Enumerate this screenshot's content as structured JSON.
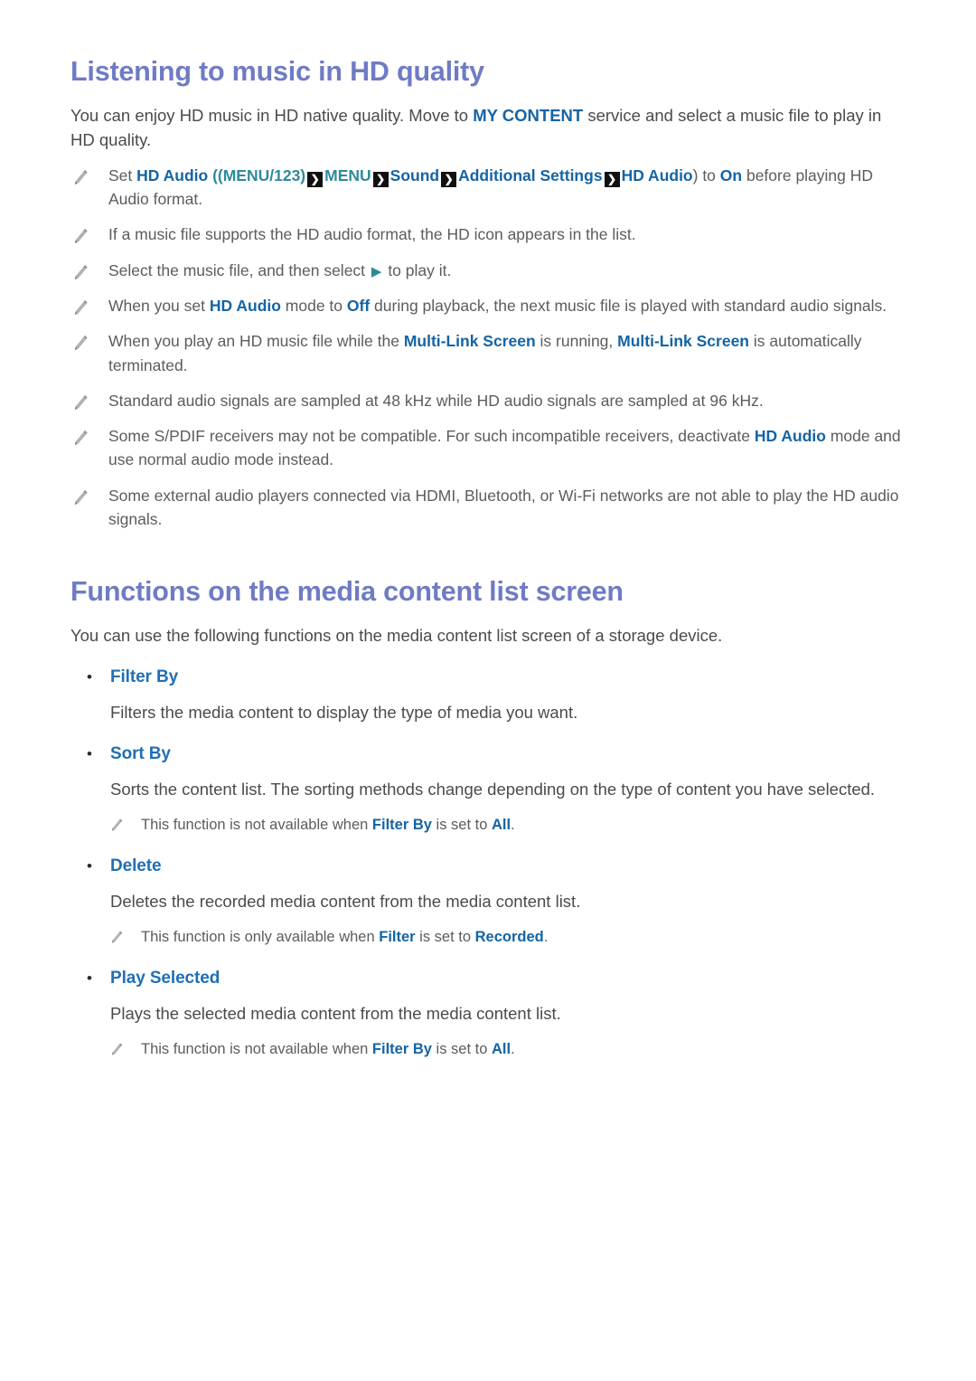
{
  "colors": {
    "heading": "#6f7bc4",
    "body": "#4b4b4b",
    "note": "#5c5c5c",
    "link_blue": "#1464a5",
    "bullet_blue": "#1f6fb5",
    "teal": "#2e8a9b",
    "arrow_bg": "#111111",
    "background": "#ffffff"
  },
  "icons": {
    "pencil": "pencil-icon",
    "arrow": "arrow-right-box-icon",
    "play": "play-triangle-icon",
    "bullet": "bullet-dot-icon"
  },
  "section1": {
    "title": "Listening to music in HD quality",
    "intro": {
      "part1": "You can enjoy HD music in HD native quality. Move to ",
      "highlight": "MY CONTENT",
      "part2": " service and select a music file to play in HD quality."
    },
    "notes": [
      {
        "id": "note-hd-audio-path",
        "segments": [
          {
            "text": "Set ",
            "style": "plain"
          },
          {
            "text": "HD Audio",
            "style": "blue"
          },
          {
            "text": " ((MENU/123)",
            "style": "teal"
          },
          {
            "text": "arrow",
            "style": "arrow"
          },
          {
            "text": "MENU",
            "style": "teal"
          },
          {
            "text": "arrow",
            "style": "arrow"
          },
          {
            "text": "Sound",
            "style": "blue"
          },
          {
            "text": "arrow",
            "style": "arrow"
          },
          {
            "text": "Additional Settings",
            "style": "blue"
          },
          {
            "text": "arrow",
            "style": "arrow"
          },
          {
            "text": "HD Audio",
            "style": "blue"
          },
          {
            "text": ") to ",
            "style": "plain"
          },
          {
            "text": "On",
            "style": "blue"
          },
          {
            "text": " before playing HD Audio format.",
            "style": "plain"
          }
        ]
      },
      {
        "id": "note-hd-icon",
        "segments": [
          {
            "text": "If a music file supports the HD audio format, the HD icon appears in the list.",
            "style": "plain"
          }
        ]
      },
      {
        "id": "note-select-play",
        "segments": [
          {
            "text": "Select the music file, and then select ",
            "style": "plain"
          },
          {
            "text": "play",
            "style": "play"
          },
          {
            "text": " to play it.",
            "style": "plain"
          }
        ]
      },
      {
        "id": "note-hd-audio-off",
        "segments": [
          {
            "text": "When you set ",
            "style": "plain"
          },
          {
            "text": "HD Audio",
            "style": "blue"
          },
          {
            "text": " mode to ",
            "style": "plain"
          },
          {
            "text": "Off",
            "style": "blue"
          },
          {
            "text": " during playback, the next music file is played with standard audio signals.",
            "style": "plain"
          }
        ]
      },
      {
        "id": "note-multi-link-screen",
        "segments": [
          {
            "text": "When you play an HD music file while the ",
            "style": "plain"
          },
          {
            "text": "Multi-Link Screen",
            "style": "blue"
          },
          {
            "text": " is running, ",
            "style": "plain"
          },
          {
            "text": "Multi-Link Screen",
            "style": "blue"
          },
          {
            "text": " is automatically terminated.",
            "style": "plain"
          }
        ]
      },
      {
        "id": "note-sampling-rates",
        "segments": [
          {
            "text": "Standard audio signals are sampled at 48 kHz while HD audio signals are sampled at 96 kHz.",
            "style": "plain"
          }
        ]
      },
      {
        "id": "note-spdif",
        "segments": [
          {
            "text": "Some S/PDIF receivers may not be compatible. For such incompatible receivers, deactivate ",
            "style": "plain"
          },
          {
            "text": "HD Audio",
            "style": "blue"
          },
          {
            "text": " mode and use normal audio mode instead.",
            "style": "plain"
          }
        ]
      },
      {
        "id": "note-external-players",
        "segments": [
          {
            "text": "Some external audio players connected via HDMI, Bluetooth, or Wi-Fi networks are not able to play the HD audio signals.",
            "style": "plain"
          }
        ]
      }
    ]
  },
  "section2": {
    "title": "Functions on the media content list screen",
    "intro": "You can use the following functions on the media content list screen of a storage device.",
    "items": [
      {
        "label": "Filter By",
        "description": "Filters the media content to display the type of media you want.",
        "subnotes": []
      },
      {
        "label": "Sort By",
        "description": "Sorts the content list. The sorting methods change depending on the type of content you have selected.",
        "subnotes": [
          {
            "segments": [
              {
                "text": "This function is not available when ",
                "style": "plain"
              },
              {
                "text": "Filter By",
                "style": "blue"
              },
              {
                "text": " is set to ",
                "style": "plain"
              },
              {
                "text": "All",
                "style": "blue"
              },
              {
                "text": ".",
                "style": "plain"
              }
            ]
          }
        ]
      },
      {
        "label": "Delete",
        "description": "Deletes the recorded media content from the media content list.",
        "subnotes": [
          {
            "segments": [
              {
                "text": "This function is only available when ",
                "style": "plain"
              },
              {
                "text": "Filter",
                "style": "blue"
              },
              {
                "text": " is set to ",
                "style": "plain"
              },
              {
                "text": "Recorded",
                "style": "blue"
              },
              {
                "text": ".",
                "style": "plain"
              }
            ]
          }
        ]
      },
      {
        "label": "Play Selected",
        "description": "Plays the selected media content from the media content list.",
        "subnotes": [
          {
            "segments": [
              {
                "text": "This function is not available when ",
                "style": "plain"
              },
              {
                "text": "Filter By",
                "style": "blue"
              },
              {
                "text": " is set to ",
                "style": "plain"
              },
              {
                "text": "All",
                "style": "blue"
              },
              {
                "text": ".",
                "style": "plain"
              }
            ]
          }
        ]
      }
    ]
  }
}
